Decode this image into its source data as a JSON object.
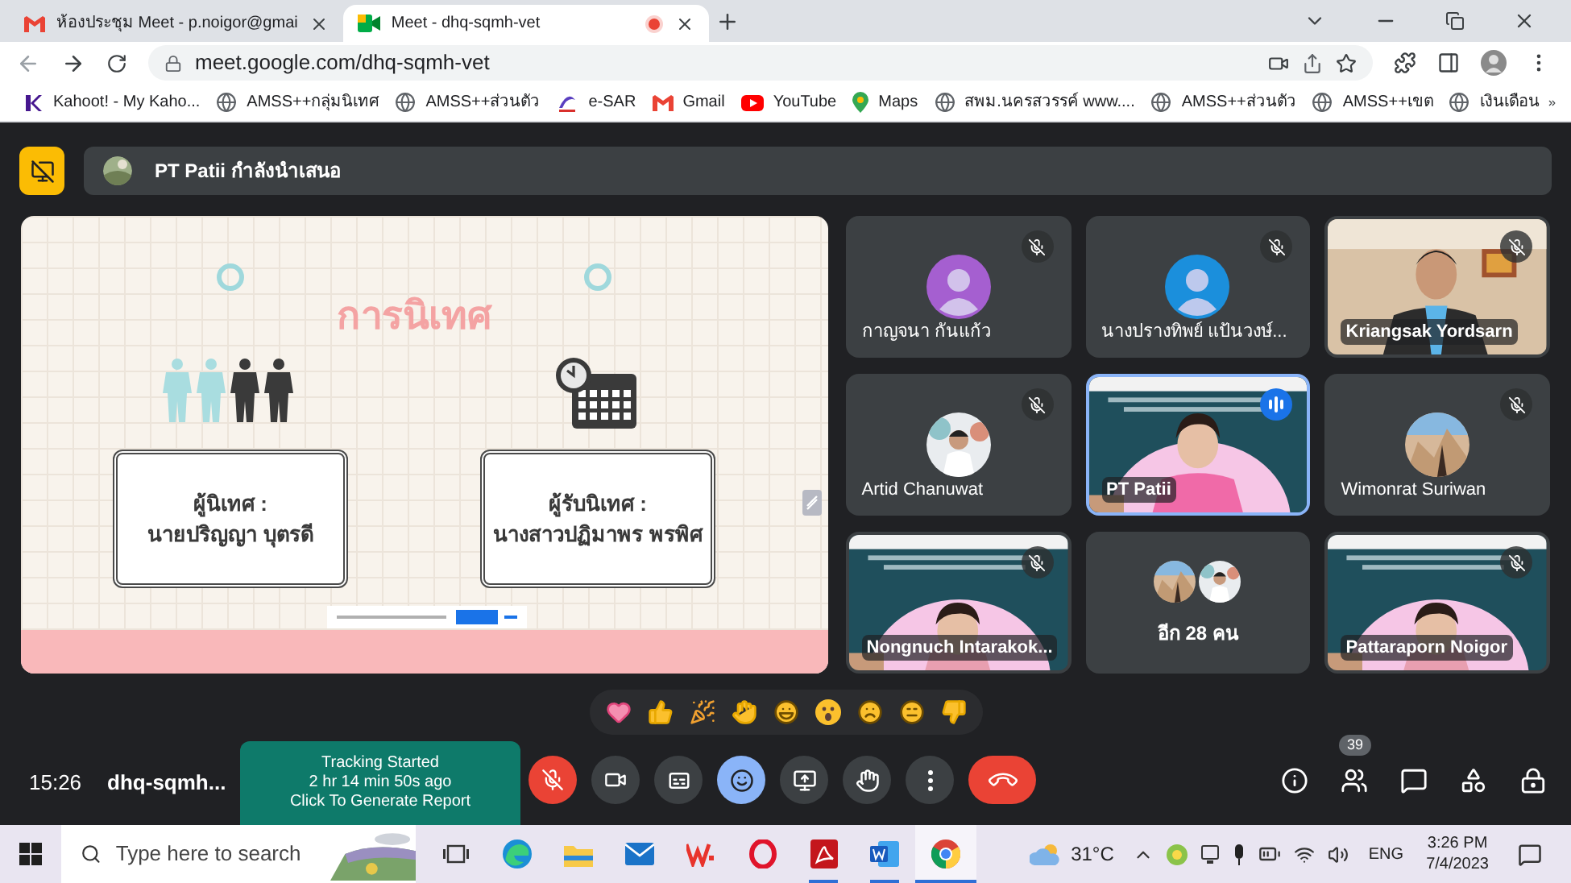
{
  "browser": {
    "tabs": [
      {
        "title": "ห้องประชุม Meet - p.noigor@gmai",
        "selected": false,
        "recording": false
      },
      {
        "title": "Meet - dhq-sqmh-vet",
        "selected": true,
        "recording": true
      }
    ],
    "url": "meet.google.com/dhq-sqmh-vet",
    "bookmarks": [
      {
        "label": "Kahoot! - My Kaho..."
      },
      {
        "label": "AMSS++กลุ่มนิเทศ"
      },
      {
        "label": "AMSS++ส่วนตัว"
      },
      {
        "label": "e-SAR"
      },
      {
        "label": "Gmail"
      },
      {
        "label": "YouTube"
      },
      {
        "label": "Maps"
      },
      {
        "label": "สพม.นครสวรรค์ www...."
      },
      {
        "label": "AMSS++ส่วนตัว"
      },
      {
        "label": "AMSS++เขต"
      },
      {
        "label": "เงินเดือน"
      }
    ]
  },
  "meet": {
    "presenter": "PT Patii กำลังนำเสนอ",
    "slide": {
      "title": "การนิเทศ",
      "cards": [
        {
          "label": "ผู้นิเทศ :",
          "name": "นายปริญญา บุตรดี"
        },
        {
          "label": "ผู้รับนิเทศ :",
          "name": "นางสาวปฏิมาพร พรพิศ"
        }
      ]
    },
    "tiles": [
      {
        "name": "กาญจนา กันแก้ว",
        "kind": "avatar",
        "color": "#a55fd0",
        "muted": true,
        "speaking": false
      },
      {
        "name": "นางปรางทิพย์ แป้นวงษ์...",
        "kind": "avatar",
        "color": "#1b8fdc",
        "muted": true,
        "speaking": false
      },
      {
        "name": "Kriangsak Yordsarn",
        "kind": "video",
        "muted": true,
        "speaking": false
      },
      {
        "name": "Artid Chanuwat",
        "muted": true,
        "speaking": false
      },
      {
        "name": "PT Patii",
        "kind": "video",
        "muted": false,
        "speaking": true
      },
      {
        "name": "Wimonrat Suriwan",
        "muted": true,
        "speaking": false
      },
      {
        "name": "Nongnuch Intarakok...",
        "kind": "video",
        "muted": true,
        "speaking": false
      },
      {
        "name": "อีก 28 คน",
        "kind": "more",
        "muted": false,
        "speaking": false
      },
      {
        "name": "Pattaraporn Noigor",
        "kind": "video",
        "muted": true,
        "speaking": false
      }
    ],
    "time": "15:26",
    "code": "dhq-sqmh...",
    "tracking": [
      "Tracking Started",
      "2 hr 14 min 50s ago",
      "Click To Generate Report"
    ],
    "controls": [
      {
        "kind": "mic",
        "on": false
      },
      {
        "kind": "camera",
        "on": true
      },
      {
        "kind": "captions",
        "on": false
      },
      {
        "kind": "reactions",
        "on": true
      },
      {
        "kind": "present",
        "on": false
      },
      {
        "kind": "hand",
        "on": false
      },
      {
        "kind": "more",
        "on": false
      },
      {
        "kind": "leave"
      }
    ],
    "people_count": "39"
  },
  "taskbar": {
    "search_placeholder": "Type here to search",
    "apps": [
      {
        "kind": "taskview",
        "running": false,
        "selected": false
      },
      {
        "kind": "edge",
        "running": false,
        "selected": false
      },
      {
        "kind": "explorer",
        "running": false,
        "selected": false
      },
      {
        "kind": "mail",
        "running": false,
        "selected": false
      },
      {
        "kind": "wps",
        "running": false,
        "selected": false
      },
      {
        "kind": "opera",
        "running": false,
        "selected": false
      },
      {
        "kind": "acrobat",
        "running": true,
        "selected": false
      },
      {
        "kind": "word",
        "running": true,
        "selected": false
      },
      {
        "kind": "chrome",
        "running": true,
        "selected": true
      }
    ],
    "temperature": "31°C",
    "language": "ENG",
    "time": "3:26 PM",
    "date": "7/4/2023"
  }
}
